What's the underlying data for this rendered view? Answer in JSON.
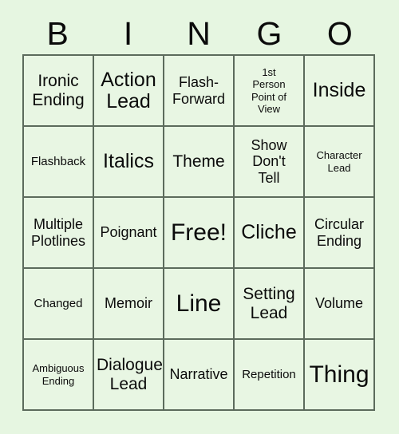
{
  "card": {
    "title": "BINGO Card",
    "background_color": "#e6f6e1",
    "border_color": "#5c6b5c",
    "text_color": "#0b0b0b",
    "header": {
      "letters": [
        "B",
        "I",
        "N",
        "G",
        "O"
      ]
    },
    "grid": {
      "columns": 5,
      "rows": 5,
      "cells": [
        {
          "text": "Ironic\nEnding",
          "size": "l",
          "row": 1,
          "col": 1
        },
        {
          "text": "Action\nLead",
          "size": "xl",
          "row": 1,
          "col": 2
        },
        {
          "text": "Flash-\nForward",
          "size": "m",
          "row": 1,
          "col": 3
        },
        {
          "text": "1st\nPerson\nPoint of\nView",
          "size": "xs",
          "row": 1,
          "col": 4
        },
        {
          "text": "Inside",
          "size": "xl",
          "row": 1,
          "col": 5
        },
        {
          "text": "Flashback",
          "size": "s",
          "row": 2,
          "col": 1
        },
        {
          "text": "Italics",
          "size": "xl",
          "row": 2,
          "col": 2
        },
        {
          "text": "Theme",
          "size": "l",
          "row": 2,
          "col": 3
        },
        {
          "text": "Show\nDon't\nTell",
          "size": "m",
          "row": 2,
          "col": 4
        },
        {
          "text": "Character\nLead",
          "size": "xs",
          "row": 2,
          "col": 5
        },
        {
          "text": "Multiple\nPlotlines",
          "size": "m",
          "row": 3,
          "col": 1
        },
        {
          "text": "Poignant",
          "size": "m",
          "row": 3,
          "col": 2
        },
        {
          "text": "Free!",
          "size": "xxl",
          "row": 3,
          "col": 3
        },
        {
          "text": "Cliche",
          "size": "xl",
          "row": 3,
          "col": 4
        },
        {
          "text": "Circular\nEnding",
          "size": "m",
          "row": 3,
          "col": 5
        },
        {
          "text": "Changed",
          "size": "s",
          "row": 4,
          "col": 1
        },
        {
          "text": "Memoir",
          "size": "m",
          "row": 4,
          "col": 2
        },
        {
          "text": "Line",
          "size": "xxl",
          "row": 4,
          "col": 3
        },
        {
          "text": "Setting\nLead",
          "size": "l",
          "row": 4,
          "col": 4
        },
        {
          "text": "Volume",
          "size": "m",
          "row": 4,
          "col": 5
        },
        {
          "text": "Ambiguous\nEnding",
          "size": "xs",
          "row": 5,
          "col": 1
        },
        {
          "text": "Dialogue\nLead",
          "size": "l",
          "row": 5,
          "col": 2
        },
        {
          "text": "Narrative",
          "size": "m",
          "row": 5,
          "col": 3
        },
        {
          "text": "Repetition",
          "size": "s",
          "row": 5,
          "col": 4
        },
        {
          "text": "Thing",
          "size": "xxl",
          "row": 5,
          "col": 5
        }
      ]
    }
  }
}
